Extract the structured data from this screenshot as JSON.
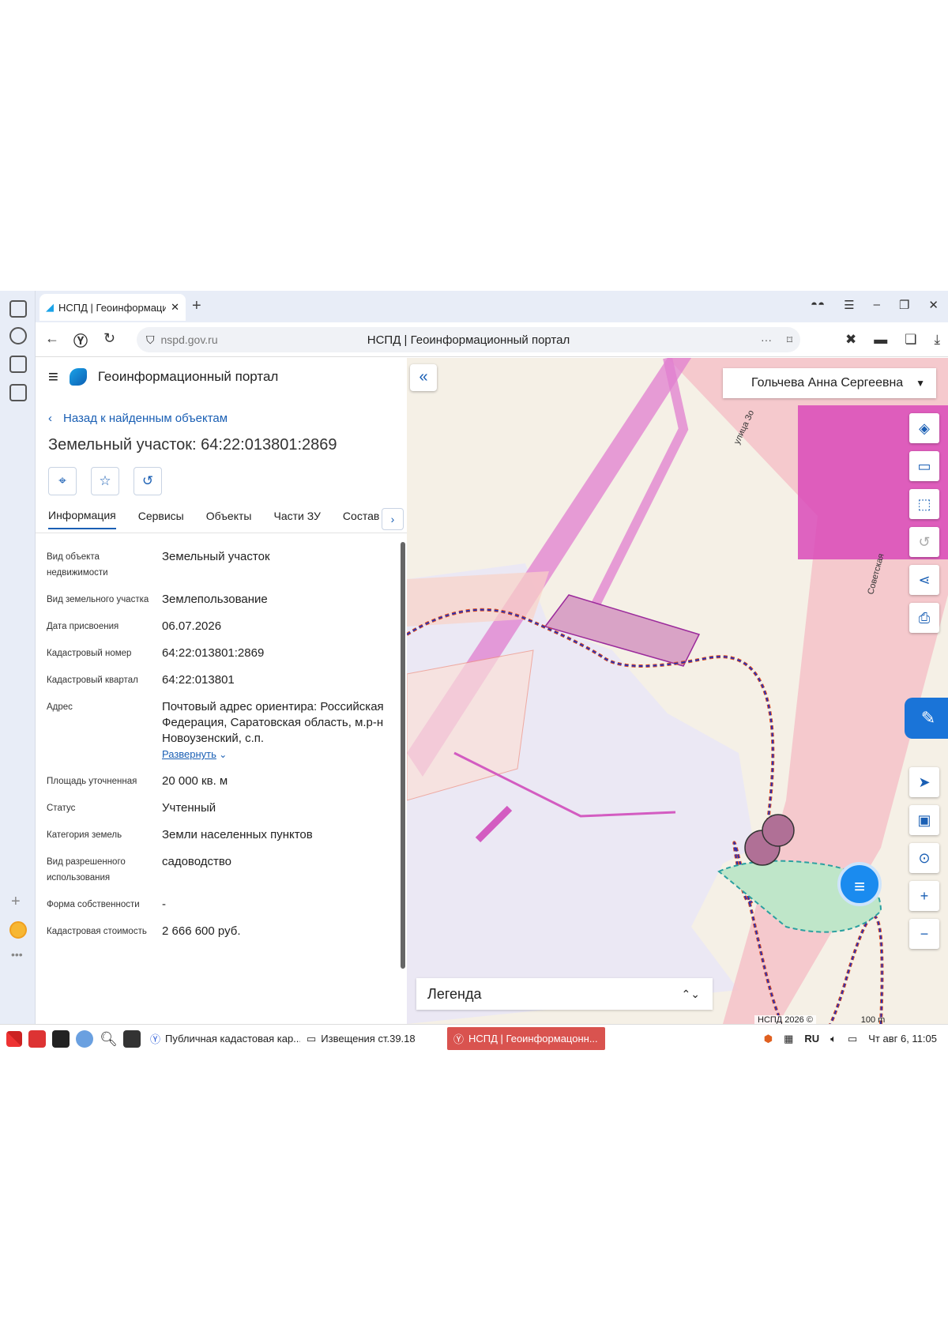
{
  "browser": {
    "tab_title": "НСПД | Геоинформаци",
    "new_tab": "+",
    "url_host": "nspd.gov.ru",
    "page_title": "НСПД | Геоинформационный портал"
  },
  "portal": {
    "name": "Геоинформационный портал",
    "back_link": "Назад к найденным объектам",
    "object_title": "Земельный участок: 64:22:013801:2869",
    "tabs": [
      {
        "label": "Информация"
      },
      {
        "label": "Сервисы"
      },
      {
        "label": "Объекты"
      },
      {
        "label": "Части ЗУ"
      },
      {
        "label": "Состав"
      }
    ],
    "rows": [
      {
        "key": "Вид объекта недвижимости",
        "value": "Земельный участок"
      },
      {
        "key": "Вид земельного участка",
        "value": "Землепользование"
      },
      {
        "key": "Дата присвоения",
        "value": "06.07.2026"
      },
      {
        "key": "Кадастровый номер",
        "value": "64:22:013801:2869"
      },
      {
        "key": "Кадастровый квартал",
        "value": "64:22:013801"
      },
      {
        "key": "Адрес",
        "value": "Почтовый адрес ориентира: Российская Федерация, Саратовская область, м.р-н Новоузенский, с.п."
      },
      {
        "key": "Площадь уточненная",
        "value": "20 000 кв. м"
      },
      {
        "key": "Статус",
        "value": "Учтенный"
      },
      {
        "key": "Категория земель",
        "value": "Земли населенных пунктов"
      },
      {
        "key": "Вид разрешенного использования",
        "value": "садоводство"
      },
      {
        "key": "Форма собственности",
        "value": "-"
      },
      {
        "key": "Кадастровая стоимость",
        "value": "2 666 600 руб."
      }
    ],
    "expand_label": "Развернуть"
  },
  "map": {
    "user_name": "Гольчева Анна Сергеевна",
    "legend_label": "Легенда",
    "attribution": "НСПД 2026 ©",
    "scale_label": "100 m",
    "street_label_1": "улица Зо",
    "street_label_2": "Советская"
  },
  "taskbar": {
    "items": [
      {
        "label": "Публичная кадастовая кар..."
      },
      {
        "label": "Извещения ст.39.18"
      },
      {
        "label": "НСПД | Геоинформацонн..."
      }
    ],
    "lang": "RU",
    "clock": "Чт авг 6, 11:05"
  }
}
